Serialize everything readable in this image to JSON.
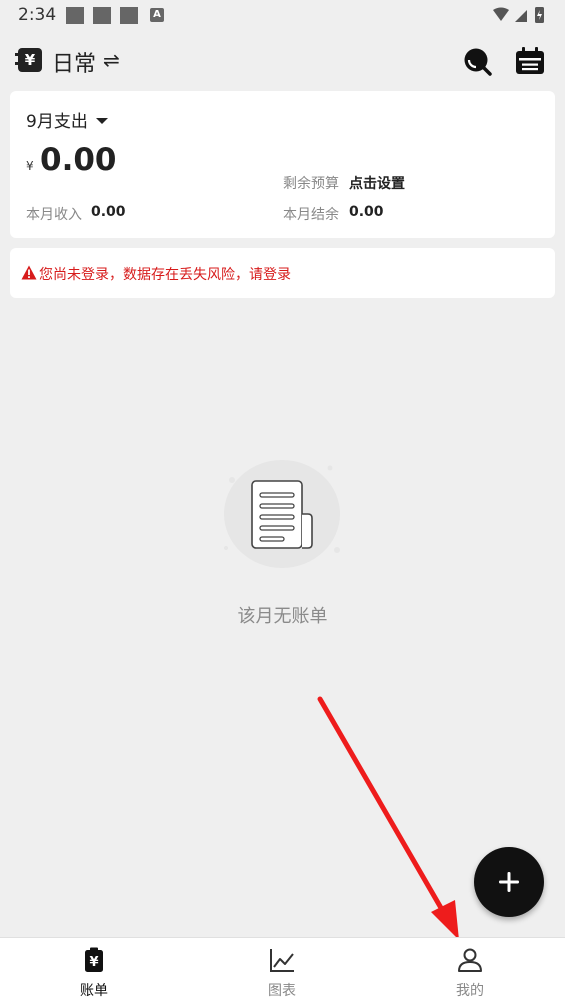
{
  "status_bar": {
    "time": "2:34",
    "notif_letter": "A"
  },
  "header": {
    "book_name": "日常",
    "book_symbol": "¥",
    "swap_symbol": "⇌"
  },
  "summary": {
    "month_label": "9月支出",
    "currency_symbol": "¥",
    "expense_amount": "0.00",
    "budget_label": "剩余预算",
    "budget_value": "点击设置",
    "income_label": "本月收入",
    "income_value": "0.00",
    "balance_label": "本月结余",
    "balance_value": "0.00"
  },
  "warning": {
    "text": "您尚未登录，数据存在丢失风险，请登录",
    "color": "#d71b1b"
  },
  "empty_state": {
    "text": "该月无账单"
  },
  "fab": {
    "icon": "plus-icon"
  },
  "bottom_nav": {
    "items": [
      {
        "label": "账单",
        "icon": "bill-icon",
        "active": true
      },
      {
        "label": "图表",
        "icon": "chart-icon",
        "active": false
      },
      {
        "label": "我的",
        "icon": "person-icon",
        "active": false
      }
    ],
    "active_color": "#111111",
    "inactive_color": "#888888"
  },
  "annotation": {
    "color": "#ee1c1c"
  }
}
